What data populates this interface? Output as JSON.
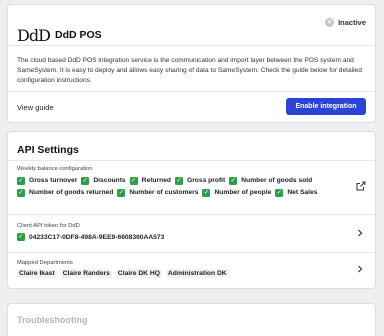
{
  "integration": {
    "logo_text": "DdD",
    "title": "DdD POS",
    "status": "Inactive",
    "description": "The cloud based DdD POS integration service is the communication and import layer between the POS system and SameSystem. It is easy to deploy and allows easy sharing of data to SameSystem. Check the guide below for detailed configuration instructions.",
    "view_guide_label": "View guide",
    "enable_button_label": "Enable integration"
  },
  "api_settings": {
    "title": "API Settings",
    "weekly_balance": {
      "label": "Weekly balance configuration",
      "items": [
        "Gross turnover",
        "Discounts",
        "Returned",
        "Gross profit",
        "Number of goods sold",
        "Number of goods returned",
        "Number of customers",
        "Number of people",
        "Net Sales"
      ]
    },
    "client_token": {
      "label": "Client API token for DdD",
      "value": "04233C17-0DF8-498A-9EE9-6608360AA573"
    },
    "mapped_departments": {
      "label": "Mapped Departments",
      "items": [
        "Claire Ikast",
        "Claire Randers",
        "Claire DK HQ",
        "Administration DK"
      ]
    }
  },
  "troubleshooting": {
    "title": "Troubleshooting"
  },
  "colors": {
    "primary": "#2c44d6",
    "check": "#2f9e4c",
    "background": "#eeeff1"
  },
  "icons": {
    "status": "close-circle-icon",
    "external": "external-link-icon",
    "chevron": "chevron-right-icon",
    "check": "checkbox-checked-icon"
  }
}
